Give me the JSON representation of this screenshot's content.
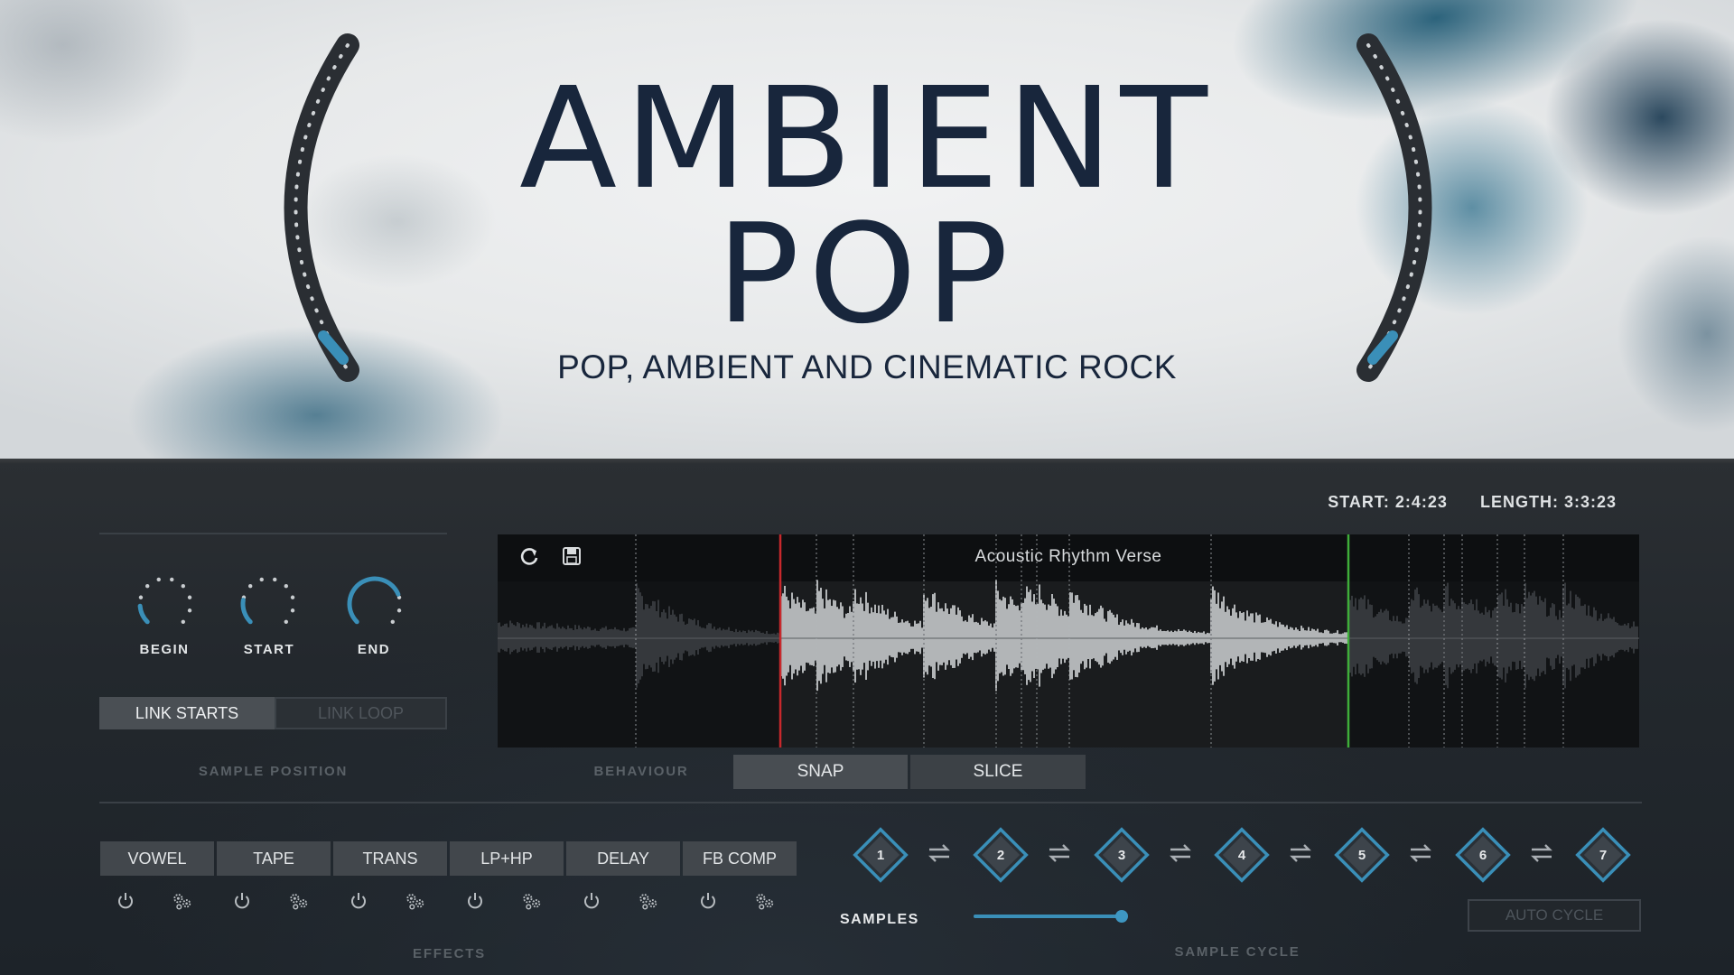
{
  "header": {
    "title_line1": "AMBIENT",
    "title_line2": "POP",
    "subtitle": "POP, AMBIENT AND CINEMATIC ROCK"
  },
  "readout": {
    "start": "START: 2:4:23",
    "length": "LENGTH: 3:3:23"
  },
  "sample_position": {
    "knobs": [
      {
        "label": "BEGIN",
        "value": 0.15
      },
      {
        "label": "START",
        "value": 0.2
      },
      {
        "label": "END",
        "value": 0.75
      }
    ],
    "link_starts": "LINK STARTS",
    "link_loop": "LINK LOOP",
    "section_label": "SAMPLE POSITION"
  },
  "waveform": {
    "title": "Acoustic Rhythm Verse",
    "icons": [
      "refresh-icon",
      "save-icon"
    ],
    "colors": {
      "start_marker": "#c8282c",
      "end_marker": "#3fae3a"
    }
  },
  "behaviour": {
    "label": "BEHAVIOUR",
    "snap": "SNAP",
    "slice": "SLICE"
  },
  "effects": {
    "label": "EFFECTS",
    "items": [
      "VOWEL",
      "TAPE",
      "TRANS",
      "LP+HP",
      "DELAY",
      "FB COMP"
    ],
    "icons": [
      "power-icon",
      "settings-icon"
    ]
  },
  "sample_cycle": {
    "slots": [
      "1",
      "2",
      "3",
      "4",
      "5",
      "6",
      "7"
    ],
    "samples_label": "SAMPLES",
    "samples_value": 1.0,
    "auto_cycle": "AUTO CYCLE",
    "section_label": "SAMPLE CYCLE"
  },
  "accent": "#3a8fb8"
}
